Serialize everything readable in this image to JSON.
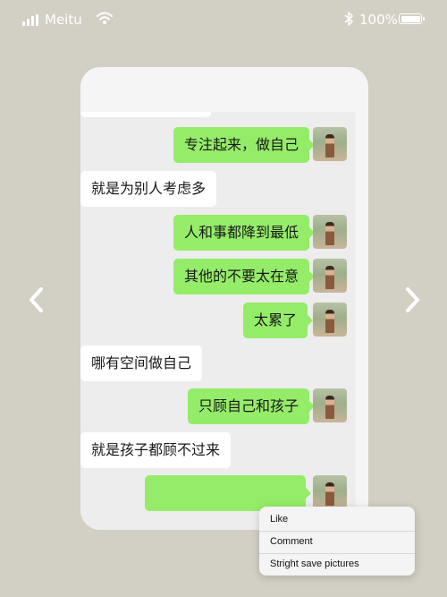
{
  "status_bar": {
    "carrier": "Meitu",
    "battery": "100%"
  },
  "chat": {
    "messages": [
      {
        "side": "left",
        "text": ""
      },
      {
        "side": "right",
        "text": "专注起来，做自己"
      },
      {
        "side": "left",
        "text": "就是为别人考虑多"
      },
      {
        "side": "right",
        "text": "人和事都降到最低"
      },
      {
        "side": "right",
        "text": "其他的不要太在意"
      },
      {
        "side": "right",
        "text": "太累了"
      },
      {
        "side": "left",
        "text": "哪有空间做自己"
      },
      {
        "side": "right",
        "text": "只顾自己和孩子"
      },
      {
        "side": "left",
        "text": "就是孩子都顾不过来"
      },
      {
        "side": "right",
        "text": ""
      }
    ]
  },
  "context_menu": {
    "items": [
      {
        "label": "Like"
      },
      {
        "label": "Comment"
      },
      {
        "label": "Stright save pictures"
      }
    ]
  },
  "colors": {
    "background": "#d2cfc5",
    "bubble_green": "#95ec69",
    "chat_bg": "#ededed"
  },
  "icons": [
    "signal-icon",
    "wifi-icon",
    "bluetooth-icon",
    "battery-icon",
    "chevron-left-icon",
    "chevron-right-icon"
  ]
}
